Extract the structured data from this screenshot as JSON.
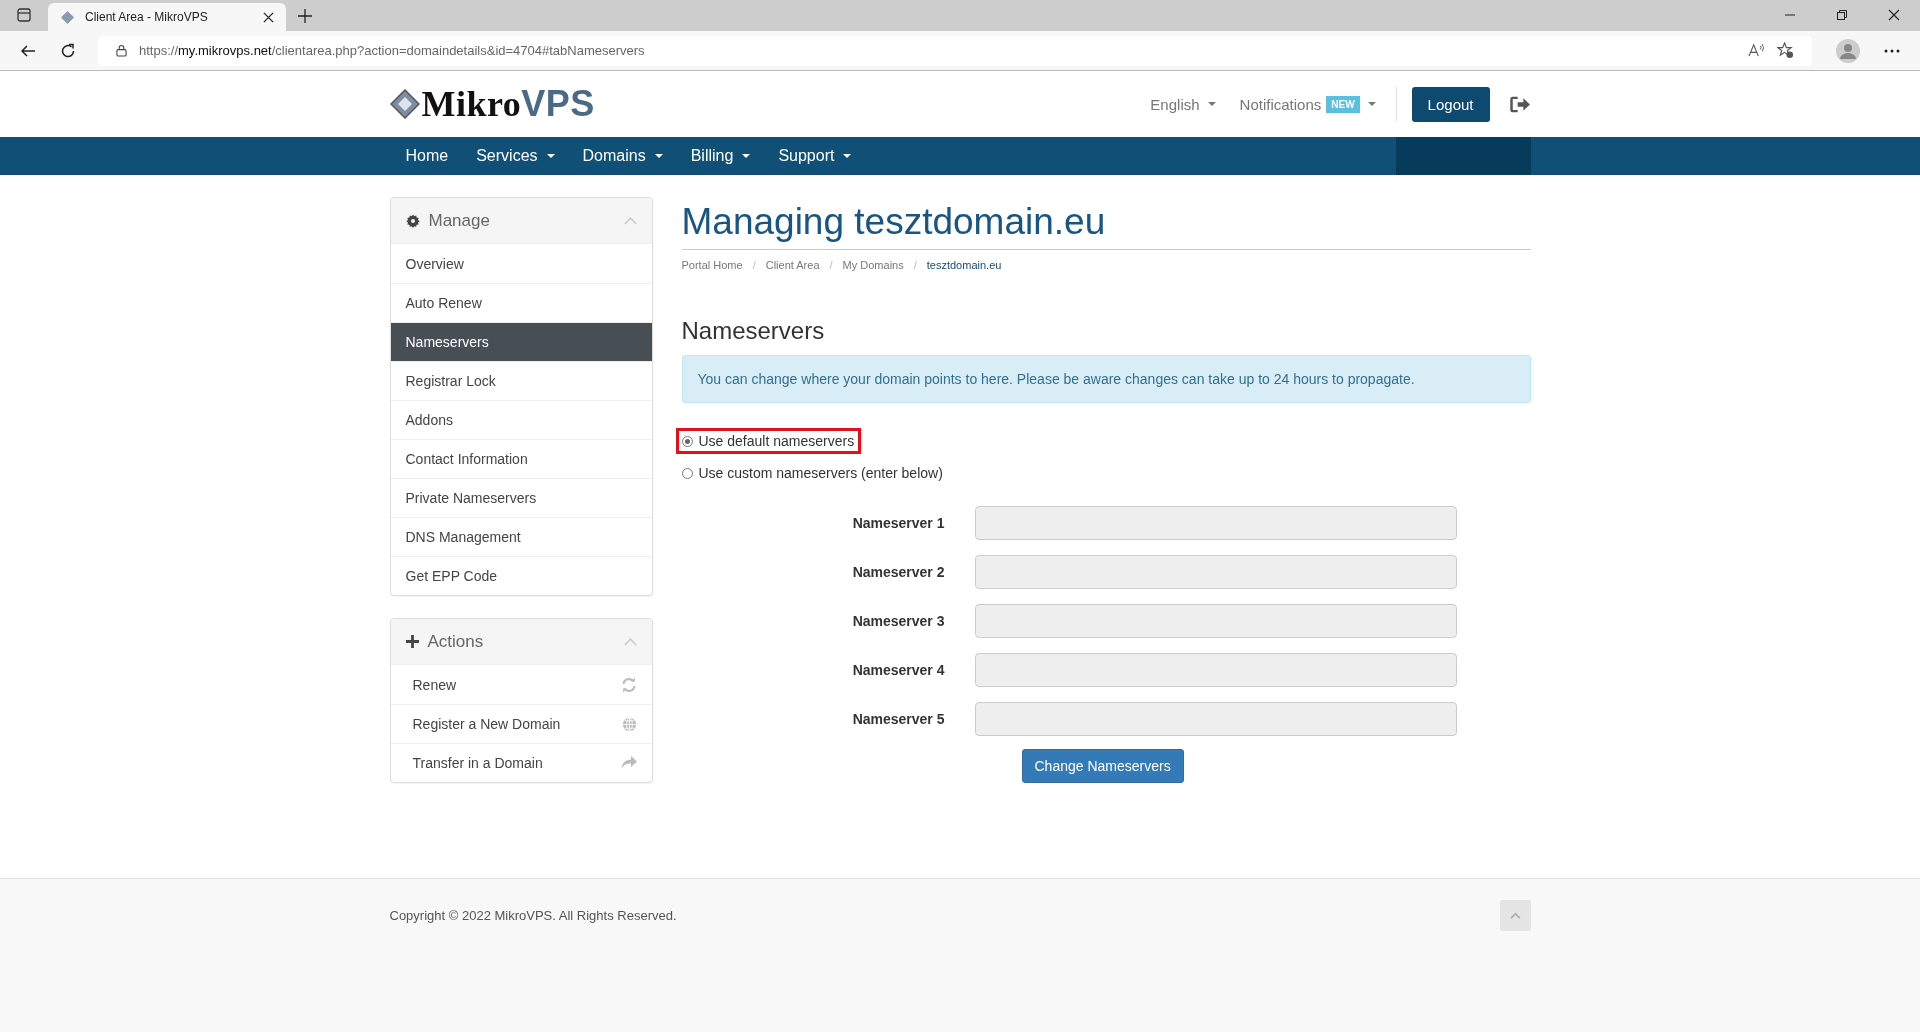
{
  "browser": {
    "tab_title": "Client Area - MikroVPS",
    "url_scheme": "https://",
    "url_host": "my.mikrovps.net",
    "url_path": "/clientarea.php?action=domaindetails&id=4704#tabNameservers"
  },
  "header": {
    "logo_dark": "Mikro",
    "logo_light": "VPS",
    "language": "English",
    "notifications": "Notifications",
    "notifications_badge": "NEW",
    "logout": "Logout"
  },
  "nav": [
    {
      "label": "Home",
      "dropdown": false
    },
    {
      "label": "Services",
      "dropdown": true
    },
    {
      "label": "Domains",
      "dropdown": true
    },
    {
      "label": "Billing",
      "dropdown": true
    },
    {
      "label": "Support",
      "dropdown": true
    }
  ],
  "sidebar": [
    {
      "title": "Manage",
      "kind": "manage",
      "items": [
        {
          "label": "Overview",
          "selected": false
        },
        {
          "label": "Auto Renew",
          "selected": false
        },
        {
          "label": "Nameservers",
          "selected": true
        },
        {
          "label": "Registrar Lock",
          "selected": false
        },
        {
          "label": "Addons",
          "selected": false
        },
        {
          "label": "Contact Information",
          "selected": false
        },
        {
          "label": "Private Nameservers",
          "selected": false
        },
        {
          "label": "DNS Management",
          "selected": false
        },
        {
          "label": "Get EPP Code",
          "selected": false
        }
      ]
    },
    {
      "title": "Actions",
      "kind": "actions",
      "items": [
        {
          "label": "Renew",
          "selected": false
        },
        {
          "label": "Register a New Domain",
          "selected": false
        },
        {
          "label": "Transfer in a Domain",
          "selected": false
        }
      ]
    }
  ],
  "page": {
    "title": "Managing tesztdomain.eu",
    "breadcrumb": [
      {
        "label": "Portal Home",
        "active": false
      },
      {
        "separator": "/",
        "label": "Client Area",
        "active": false
      },
      {
        "separator": "/",
        "label": "My Domains",
        "active": false
      },
      {
        "separator": "/",
        "label": "tesztdomain.eu",
        "active": true
      }
    ],
    "section_title": "Nameservers",
    "info": "You can change where your domain points to here. Please be aware changes can take up to 24 hours to propagate.",
    "options": [
      {
        "label": "Use default nameservers",
        "selected": true,
        "highlighted": true
      },
      {
        "label": "Use custom nameservers (enter below)",
        "selected": false,
        "highlighted": false
      }
    ],
    "nameservers": [
      {
        "label": "Nameserver 1",
        "disabled": true
      },
      {
        "label": "Nameserver 2",
        "disabled": true
      },
      {
        "label": "Nameserver 3",
        "disabled": true
      },
      {
        "label": "Nameserver 4",
        "disabled": true
      },
      {
        "label": "Nameserver 5",
        "disabled": true
      }
    ],
    "submit": "Change Nameservers"
  },
  "footer": {
    "copyright": "Copyright © 2022 MikroVPS. All Rights Reserved."
  }
}
